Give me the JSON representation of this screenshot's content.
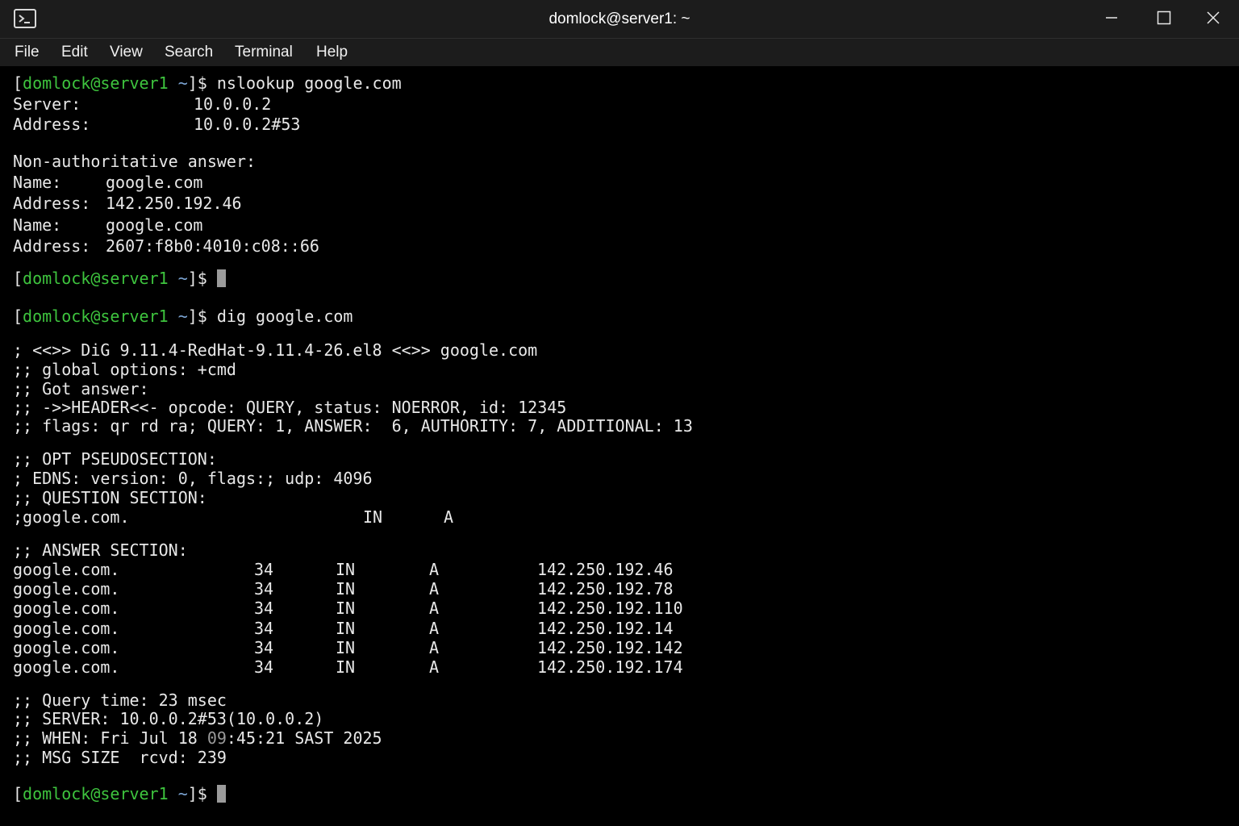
{
  "window": {
    "title": "domlock@server1: ~",
    "icon": "terminal-icon"
  },
  "controls": [
    "minimize-icon",
    "maximize-icon",
    "close-icon"
  ],
  "menu": [
    "File",
    "Edit",
    "View",
    "Search",
    "Terminal",
    "Help"
  ],
  "prompt": {
    "open": "[",
    "user": "domlock@server1",
    "tilde": " ~",
    "close": "]$ "
  },
  "commands": {
    "nslookup": "nslookup google.com",
    "dig": "dig google.com"
  },
  "nslookup": {
    "server_label": "Server:",
    "server_value": "10.0.0.2",
    "address_label": "Address:",
    "address_value": "10.0.0.2#53",
    "non_auth": "Non-authoritative answer:",
    "answers": [
      {
        "label": "Name:",
        "value": "google.com"
      },
      {
        "label": "Address:",
        "value": "142.250.192.46"
      },
      {
        "label": "Name:",
        "value": "google.com"
      },
      {
        "label": "Address:",
        "value": "2607:f8b0:4010:c08::66"
      }
    ]
  },
  "dig": {
    "banner": "; <<>> DiG 9.11.4-RedHat-9.11.4-26.el8 <<>> google.com",
    "global_options": ";; global options: +cmd",
    "got_answer": ";; Got answer:",
    "header": ";; ->>HEADER<<- opcode: QUERY, status: NOERROR, id: 12345",
    "flags": ";; flags: qr rd ra; QUERY: 1, ANSWER:  6, AUTHORITY: 7, ADDITIONAL: 13",
    "opt_section": ";; OPT PSEUDOSECTION:",
    "edns": "; EDNS: version: 0, flags:; udp: 4096",
    "question_section": ";; QUESTION SECTION:",
    "question": {
      "name": ";google.com.",
      "class": "IN",
      "type": "A"
    },
    "answer_section": ";; ANSWER SECTION:",
    "answers": [
      {
        "name": "google.com.",
        "ttl": "34",
        "class": "IN",
        "type": "A",
        "address": "142.250.192.46"
      },
      {
        "name": "google.com.",
        "ttl": "34",
        "class": "IN",
        "type": "A",
        "address": "142.250.192.78"
      },
      {
        "name": "google.com.",
        "ttl": "34",
        "class": "IN",
        "type": "A",
        "address": "142.250.192.110"
      },
      {
        "name": "google.com.",
        "ttl": "34",
        "class": "IN",
        "type": "A",
        "address": "142.250.192.14"
      },
      {
        "name": "google.com.",
        "ttl": "34",
        "class": "IN",
        "type": "A",
        "address": "142.250.192.142"
      },
      {
        "name": "google.com.",
        "ttl": "34",
        "class": "IN",
        "type": "A",
        "address": "142.250.192.174"
      }
    ],
    "query_time": ";; Query time: 23 msec",
    "server": ";; SERVER: 10.0.0.2#53(10.0.0.2)",
    "when_prefix": ";; WHEN: Fri Jul 18 ",
    "when_hour": "09",
    "when_suffix": ":45:21 SAST 2025",
    "msg_size": ";; MSG SIZE  rcvd: 239"
  },
  "colors": {
    "prompt_user": "#3ec43e",
    "prompt_tilde": "#7da6d6",
    "titlebar": "#1c1c1c",
    "terminal_bg": "#000000"
  }
}
